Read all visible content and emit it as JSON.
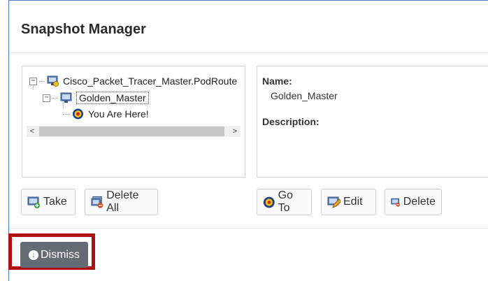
{
  "dialog": {
    "title": "Snapshot Manager"
  },
  "tree": {
    "root_label": "Cisco_Packet_Tracer_Master.PodRoute",
    "child_label": "Golden_Master",
    "current_label": "You Are Here!"
  },
  "info": {
    "name_label": "Name:",
    "name_value": "Golden_Master",
    "description_label": "Description:",
    "description_value": ""
  },
  "buttons": {
    "take": "Take",
    "delete_all": "Delete All",
    "go_to": "Go To",
    "edit": "Edit",
    "delete": "Delete",
    "dismiss": "Dismiss"
  },
  "colors": {
    "accent_border": "#4a7cc4",
    "dismiss_bg": "#646b74",
    "highlight": "#b01010"
  },
  "icons": {
    "tree_root": "vm-snapshot-icon",
    "tree_child": "snapshot-icon",
    "tree_current": "target-icon"
  }
}
